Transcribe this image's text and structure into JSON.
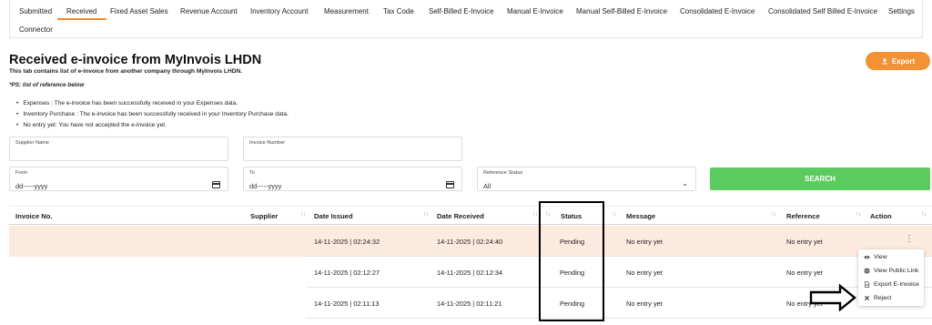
{
  "tabs": [
    {
      "label": "Submitted"
    },
    {
      "label": "Received"
    },
    {
      "label": "Fixed Asset Sales"
    },
    {
      "label": "Revenue Account"
    },
    {
      "label": "Inventory Account"
    },
    {
      "label": "Measurement"
    },
    {
      "label": "Tax Code"
    },
    {
      "label": "Self-Billed E-Invoice"
    },
    {
      "label": "Manual E-Invoice"
    },
    {
      "label": "Manual Self-Billed E-Invoice"
    },
    {
      "label": "Consolidated E-Invoice"
    },
    {
      "label": "Consolidated Self Billed E-Invoice"
    },
    {
      "label": "Settings"
    },
    {
      "label": "Connector"
    }
  ],
  "active_tab": "Received",
  "page": {
    "title": "Received e-invoice from MyInvois LHDN",
    "subtitle": "This tab contains list of e-invoice from another company through MyInvois LHDN.",
    "ps_note": "*PS: list of reference below",
    "legend": [
      "Expenses : The e-invoice has been successfully received in your Expenses data.",
      "Inventory Purchase : The e-invoice has been successfully received in your Inventory Purchase data.",
      "No entry yet: You have not accepted the e-invoice yet."
    ],
    "export_label": "Export"
  },
  "filters": {
    "supplier_name_label": "Supplier Name",
    "supplier_name_value": "",
    "invoice_number_label": "Invoice Number",
    "invoice_number_value": "",
    "from_label": "From",
    "from_value": "dd-----yyyy",
    "to_label": "To",
    "to_value": "dd-----yyyy",
    "reference_status_label": "Reference Status",
    "reference_status_value": "All",
    "search_label": "SEARCH"
  },
  "table": {
    "columns": [
      "Invoice No.",
      "Supplier",
      "Date Issued",
      "Date Received",
      "Status",
      "Message",
      "Reference",
      "Action"
    ],
    "rows": [
      {
        "invoice_no": "",
        "supplier": "",
        "date_issued": "14-11-2025 | 02:24:32",
        "date_received": "14-11-2025 | 02:24:40",
        "status": "Pending",
        "message": "No entry yet",
        "reference": "No entry yet"
      },
      {
        "invoice_no": "",
        "supplier": "",
        "date_issued": "14-11-2025 | 02:12:27",
        "date_received": "14-11-2025 | 02:12:34",
        "status": "Pending",
        "message": "No entry yet",
        "reference": "No entry yet"
      },
      {
        "invoice_no": "",
        "supplier": "",
        "date_issued": "14-11-2025 | 02:11:13",
        "date_received": "14-11-2025 | 02:11:21",
        "status": "Pending",
        "message": "No entry yet",
        "reference": "No entry yet"
      }
    ]
  },
  "action_menu": {
    "items": [
      {
        "label": "View",
        "icon": "eye-icon"
      },
      {
        "label": "View Public Link",
        "icon": "globe-icon"
      },
      {
        "label": "Export E-Invoice",
        "icon": "document-icon"
      },
      {
        "label": "Reject",
        "icon": "close-icon"
      }
    ]
  },
  "colors": {
    "accent_orange": "#f39235",
    "search_green": "#5ccb5f",
    "row_highlight": "#fdeade",
    "annotation": "#000000"
  }
}
